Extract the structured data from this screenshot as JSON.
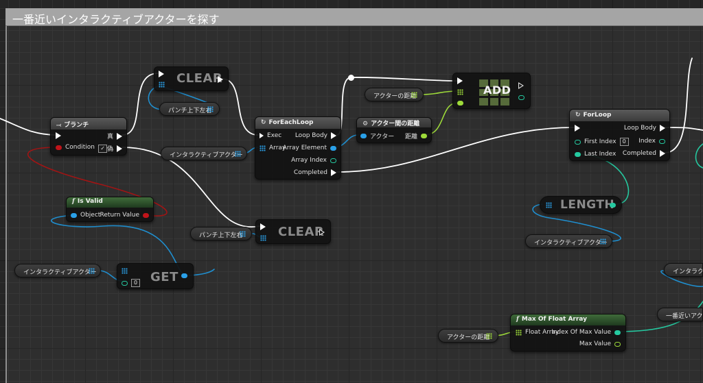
{
  "comment": {
    "title": "一番近いインタラクティブアクターを探す"
  },
  "colors": {
    "exec_wire": "#ffffff",
    "object_wire": "#1f8fd0",
    "float_wire": "#9edb3a",
    "int_wire": "#25c9a0",
    "bool_wire": "#a11414",
    "array_icon_blue": "#2aa0e8",
    "array_icon_green": "#9edb3a"
  },
  "nodes": {
    "branch": {
      "title": "ブランチ",
      "icon": "branch-icon",
      "condition_label": "Condition",
      "true_label": "真",
      "false_label": "偽"
    },
    "clear_top": {
      "title": "CLEAR"
    },
    "clear_mid": {
      "title": "CLEAR"
    },
    "foreach": {
      "title": "ForEachLoop",
      "icon": "loop-icon",
      "exec_label": "Exec",
      "array_label": "Array",
      "loop_body_label": "Loop Body",
      "array_element_label": "Array Element",
      "array_index_label": "Array Index",
      "completed_label": "Completed"
    },
    "distance": {
      "title": "アクター間の距離",
      "actor_label": "アクター",
      "distance_label": "距離"
    },
    "add": {
      "title": "ADD"
    },
    "is_valid": {
      "title": "Is Valid",
      "object_label": "Object",
      "return_label": "Return Value"
    },
    "get": {
      "title": "GET",
      "index_value": "0"
    },
    "forloop": {
      "title": "ForLoop",
      "icon": "loop-icon",
      "first_index_label": "First Index",
      "first_index_value": "0",
      "last_index_label": "Last Index",
      "loop_body_label": "Loop Body",
      "index_label": "Index",
      "completed_label": "Completed"
    },
    "length": {
      "title": "LENGTH"
    },
    "max_float": {
      "title": "Max Of Float Array",
      "float_array_label": "Float Array",
      "index_max_label": "Index Of Max Value",
      "max_value_label": "Max Value"
    }
  },
  "variables": {
    "punch_top": "パンチ上下左右",
    "interactive_1": "インタラクティブアクター",
    "actor_distance_top": "アクターの距離",
    "punch_mid": "パンチ上下左右",
    "interactive_2": "インタラクティブアクター",
    "interactive_3": "インタラクティブアクター",
    "actor_distance_bottom": "アクターの距離",
    "interactive_right": "インタラクテ",
    "nearest_right": "一番近いアクタ"
  }
}
